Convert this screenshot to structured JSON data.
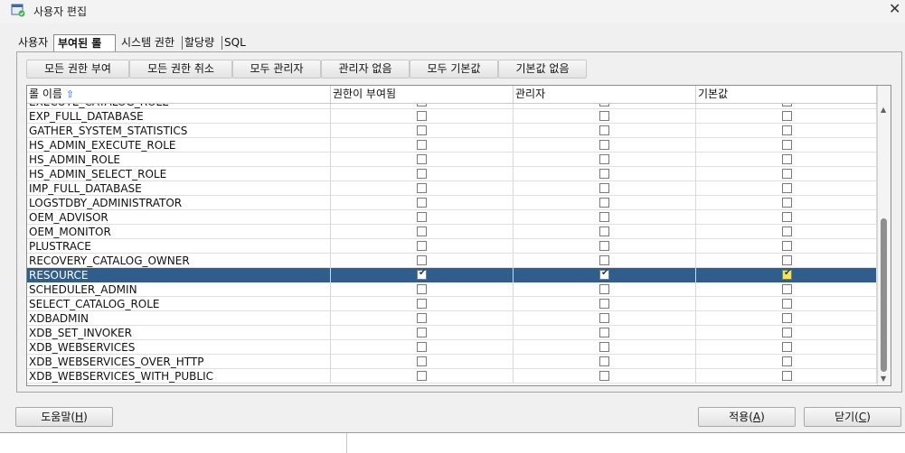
{
  "window": {
    "title": "사용자 편집",
    "icon": "user-edit-icon",
    "close_label": "✕"
  },
  "tabs": [
    {
      "label": "사용자",
      "active": false
    },
    {
      "label": "부여된 롤",
      "active": true
    },
    {
      "label": "시스템 권한",
      "active": false
    },
    {
      "label": "할당량",
      "active": false
    },
    {
      "label": "SQL",
      "active": false
    }
  ],
  "toolbar": {
    "grant_all": "모든 권한 부여",
    "revoke_all": "모든 권한 취소",
    "all_admin": "모두 관리자",
    "no_admin": "관리자 없음",
    "all_default": "모두 기본값",
    "no_default": "기본값 없음"
  },
  "grid": {
    "columns": [
      "롤 이름",
      "권한이 부여됨",
      "관리자",
      "기본값"
    ],
    "sort_icon": "sort-ascending-icon",
    "partial_top_row": "EXECUTE_CATALOG_ROLE",
    "rows": [
      {
        "name": "EXP_FULL_DATABASE",
        "granted": false,
        "admin": false,
        "default": false
      },
      {
        "name": "GATHER_SYSTEM_STATISTICS",
        "granted": false,
        "admin": false,
        "default": false
      },
      {
        "name": "HS_ADMIN_EXECUTE_ROLE",
        "granted": false,
        "admin": false,
        "default": false
      },
      {
        "name": "HS_ADMIN_ROLE",
        "granted": false,
        "admin": false,
        "default": false
      },
      {
        "name": "HS_ADMIN_SELECT_ROLE",
        "granted": false,
        "admin": false,
        "default": false
      },
      {
        "name": "IMP_FULL_DATABASE",
        "granted": false,
        "admin": false,
        "default": false
      },
      {
        "name": "LOGSTDBY_ADMINISTRATOR",
        "granted": false,
        "admin": false,
        "default": false
      },
      {
        "name": "OEM_ADVISOR",
        "granted": false,
        "admin": false,
        "default": false
      },
      {
        "name": "OEM_MONITOR",
        "granted": false,
        "admin": false,
        "default": false
      },
      {
        "name": "PLUSTRACE",
        "granted": false,
        "admin": false,
        "default": false
      },
      {
        "name": "RECOVERY_CATALOG_OWNER",
        "granted": false,
        "admin": false,
        "default": false
      },
      {
        "name": "RESOURCE",
        "granted": true,
        "admin": true,
        "default": true,
        "selected": true
      },
      {
        "name": "SCHEDULER_ADMIN",
        "granted": false,
        "admin": false,
        "default": false
      },
      {
        "name": "SELECT_CATALOG_ROLE",
        "granted": false,
        "admin": false,
        "default": false
      },
      {
        "name": "XDBADMIN",
        "granted": false,
        "admin": false,
        "default": false
      },
      {
        "name": "XDB_SET_INVOKER",
        "granted": false,
        "admin": false,
        "default": false
      },
      {
        "name": "XDB_WEBSERVICES",
        "granted": false,
        "admin": false,
        "default": false
      },
      {
        "name": "XDB_WEBSERVICES_OVER_HTTP",
        "granted": false,
        "admin": false,
        "default": false
      },
      {
        "name": "XDB_WEBSERVICES_WITH_PUBLIC",
        "granted": false,
        "admin": false,
        "default": false
      }
    ]
  },
  "footer": {
    "help": {
      "label": "도움말(",
      "mnemonic": "H",
      "suffix": ")"
    },
    "apply": {
      "label": "적용(",
      "mnemonic": "A",
      "suffix": ")"
    },
    "close": {
      "label": "닫기(",
      "mnemonic": "C",
      "suffix": ")"
    }
  },
  "colors": {
    "selection": "#2f5e8c",
    "sort_icon": "#2a6fd6",
    "default_checked_fill": "#f5e35a"
  }
}
